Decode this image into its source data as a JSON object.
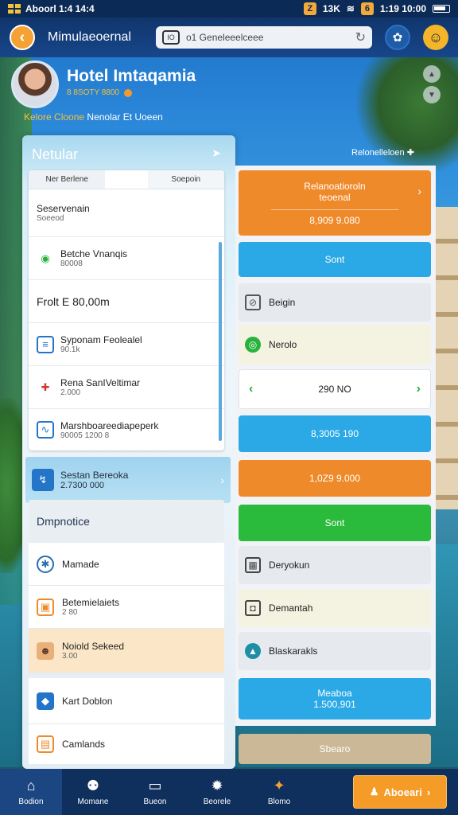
{
  "status_bar": {
    "title": "Aboorl 1:4 14:4",
    "badge_left": "Z",
    "signal_text": "13K",
    "badge_right": "6",
    "time": "1:19 10:00"
  },
  "top_bar": {
    "app_title": "Mimulaeoernal",
    "search_value": "o1 Geneleeelceee",
    "lock_label": "IO"
  },
  "profile": {
    "hotel_name": "Hotel Imtaqamia",
    "hotel_sub": "8 8SOTY 8800",
    "tagline_a": "Kelore Cloone",
    "tagline_b": "Nenolar Et Uoeen"
  },
  "left_panel": {
    "header": "Netular",
    "tabs": [
      "Ner Berlene",
      "",
      "Soepoin"
    ],
    "rows": [
      {
        "title": "Seservenain",
        "sub": "Soeeod"
      },
      {
        "title": "Betche Vnanqis",
        "sub": "80008"
      },
      {
        "title": "Frolt E 80,00m",
        "sub": ""
      },
      {
        "title": "Syponam Feolealel",
        "sub": "90.1k"
      },
      {
        "title": "Rena SanIVeltimar",
        "sub": "2.000"
      },
      {
        "title": "Marshboareediapeperk",
        "sub": "90005 1200 8"
      }
    ],
    "section": {
      "title": "Sestan Bereoka",
      "sub": "2.7300 000"
    },
    "list_header": "Dmpnotice",
    "list_rows": [
      {
        "title": "Mamade",
        "sub": ""
      },
      {
        "title": "Betemielaiets",
        "sub": "2 80"
      },
      {
        "title": "Noiold Sekeed",
        "sub": "3.00"
      },
      {
        "title": "Kart Doblon",
        "sub": ""
      },
      {
        "title": "Camlands",
        "sub": ""
      }
    ]
  },
  "right_panel": {
    "header": "Relonelleloen",
    "items": [
      {
        "title": "Relanoatioroln",
        "sub": "teoenal",
        "value": "8,909 9.080"
      },
      {
        "title": "Sont"
      },
      {
        "title": "Beigin"
      },
      {
        "title": "Nerolo"
      },
      {
        "title": "290 NO"
      },
      {
        "title": "8,3005 190"
      },
      {
        "title": "1,0Z9 9.000"
      },
      {
        "title": "Sont"
      },
      {
        "title": "Deryokun"
      },
      {
        "title": "Demantah"
      },
      {
        "title": "Blaskarakls"
      },
      {
        "title": "Meaboa",
        "sub": "1.500,901"
      },
      {
        "title": "Sbearo"
      }
    ]
  },
  "bottom_nav": {
    "items": [
      "Bodion",
      "Momane",
      "Bueon",
      "Beorele",
      "Blomo"
    ],
    "cta": "Aboeari"
  },
  "colors": {
    "accent_orange": "#ef8a2a",
    "accent_blue": "#2aa9e6",
    "accent_green": "#2bbb3c",
    "nav_bg": "#0f2f5c"
  },
  "icons": [
    "grid-icon",
    "wifi-icon",
    "battery-icon",
    "back-icon",
    "lock-icon",
    "refresh-icon",
    "settings-icon",
    "emoji-icon",
    "arrow-right-icon",
    "headset-icon",
    "document-icon",
    "location-icon",
    "chart-icon",
    "stats-icon",
    "globe-icon",
    "image-icon",
    "person-icon",
    "card-icon",
    "calendar-icon",
    "wifi-off-icon",
    "check-circle-icon",
    "chevron-left-icon",
    "chevron-right-icon",
    "building-icon",
    "lock-closed-icon",
    "mountain-icon",
    "home-icon",
    "people-icon",
    "monitor-icon",
    "gear-icon",
    "gift-icon",
    "user-icon"
  ]
}
